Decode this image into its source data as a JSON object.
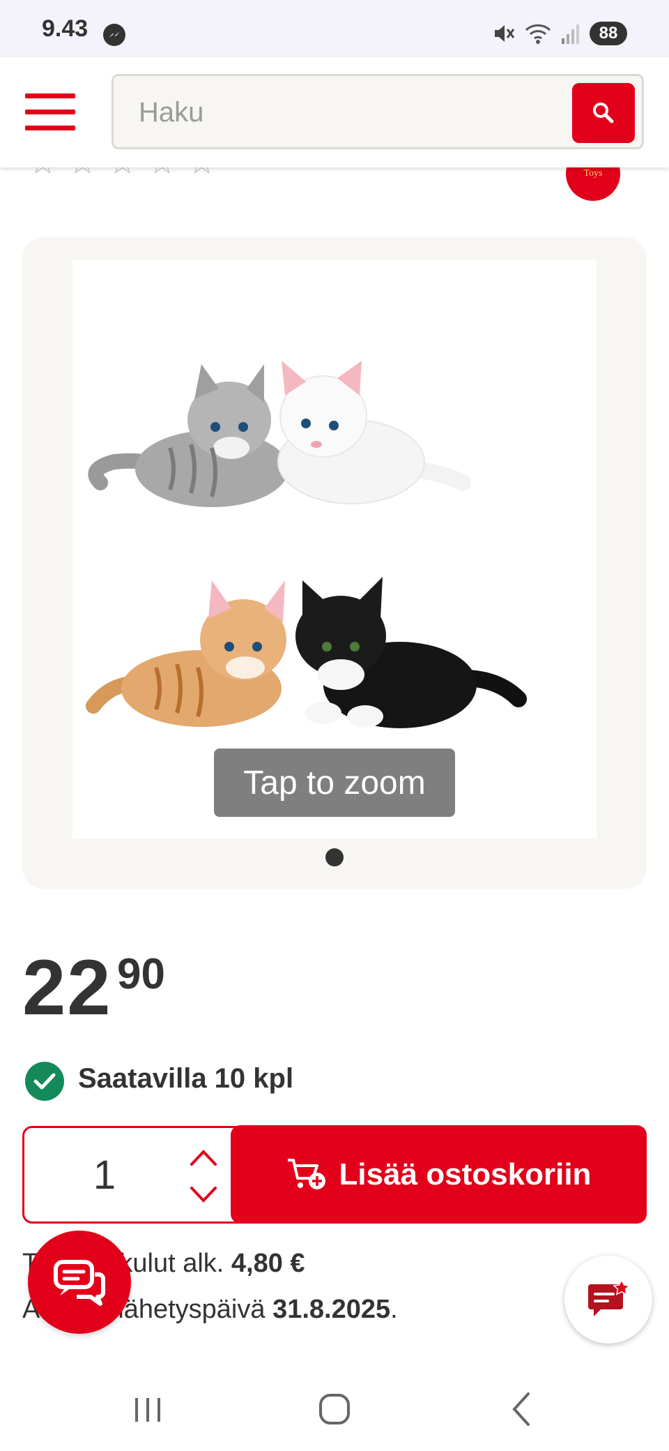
{
  "status_bar": {
    "time": "9.43",
    "battery": "88"
  },
  "header": {
    "search": {
      "placeholder": "Haku"
    }
  },
  "product": {
    "rating_stars": 0,
    "rating_max": 5,
    "brand_badge_text": "Toys",
    "image_hint": "Tap to zoom",
    "gallery_count": 1,
    "gallery_index": 0,
    "price": {
      "whole": "22",
      "cents": "90"
    },
    "availability": "Saatavilla 10 kpl",
    "quantity": "1",
    "add_to_cart_label": "Lisää ostoskoriin",
    "shipping": {
      "line1_prefix": "Toimituskulut alk.",
      "line1_value": "4,80 €",
      "line2_prefix": "Arvioitu lähetyspäivä",
      "line2_value": "31.8.2025",
      "line2_suffix": "."
    }
  },
  "colors": {
    "brand": "#e2001a",
    "success": "#148a5a",
    "text": "#333333"
  },
  "icons": {
    "menu": "hamburger-icon",
    "search": "search-icon",
    "available": "check-circle-icon",
    "cart": "cart-plus-icon",
    "chat": "chat-bubbles-icon",
    "feedback": "feedback-star-icon"
  }
}
